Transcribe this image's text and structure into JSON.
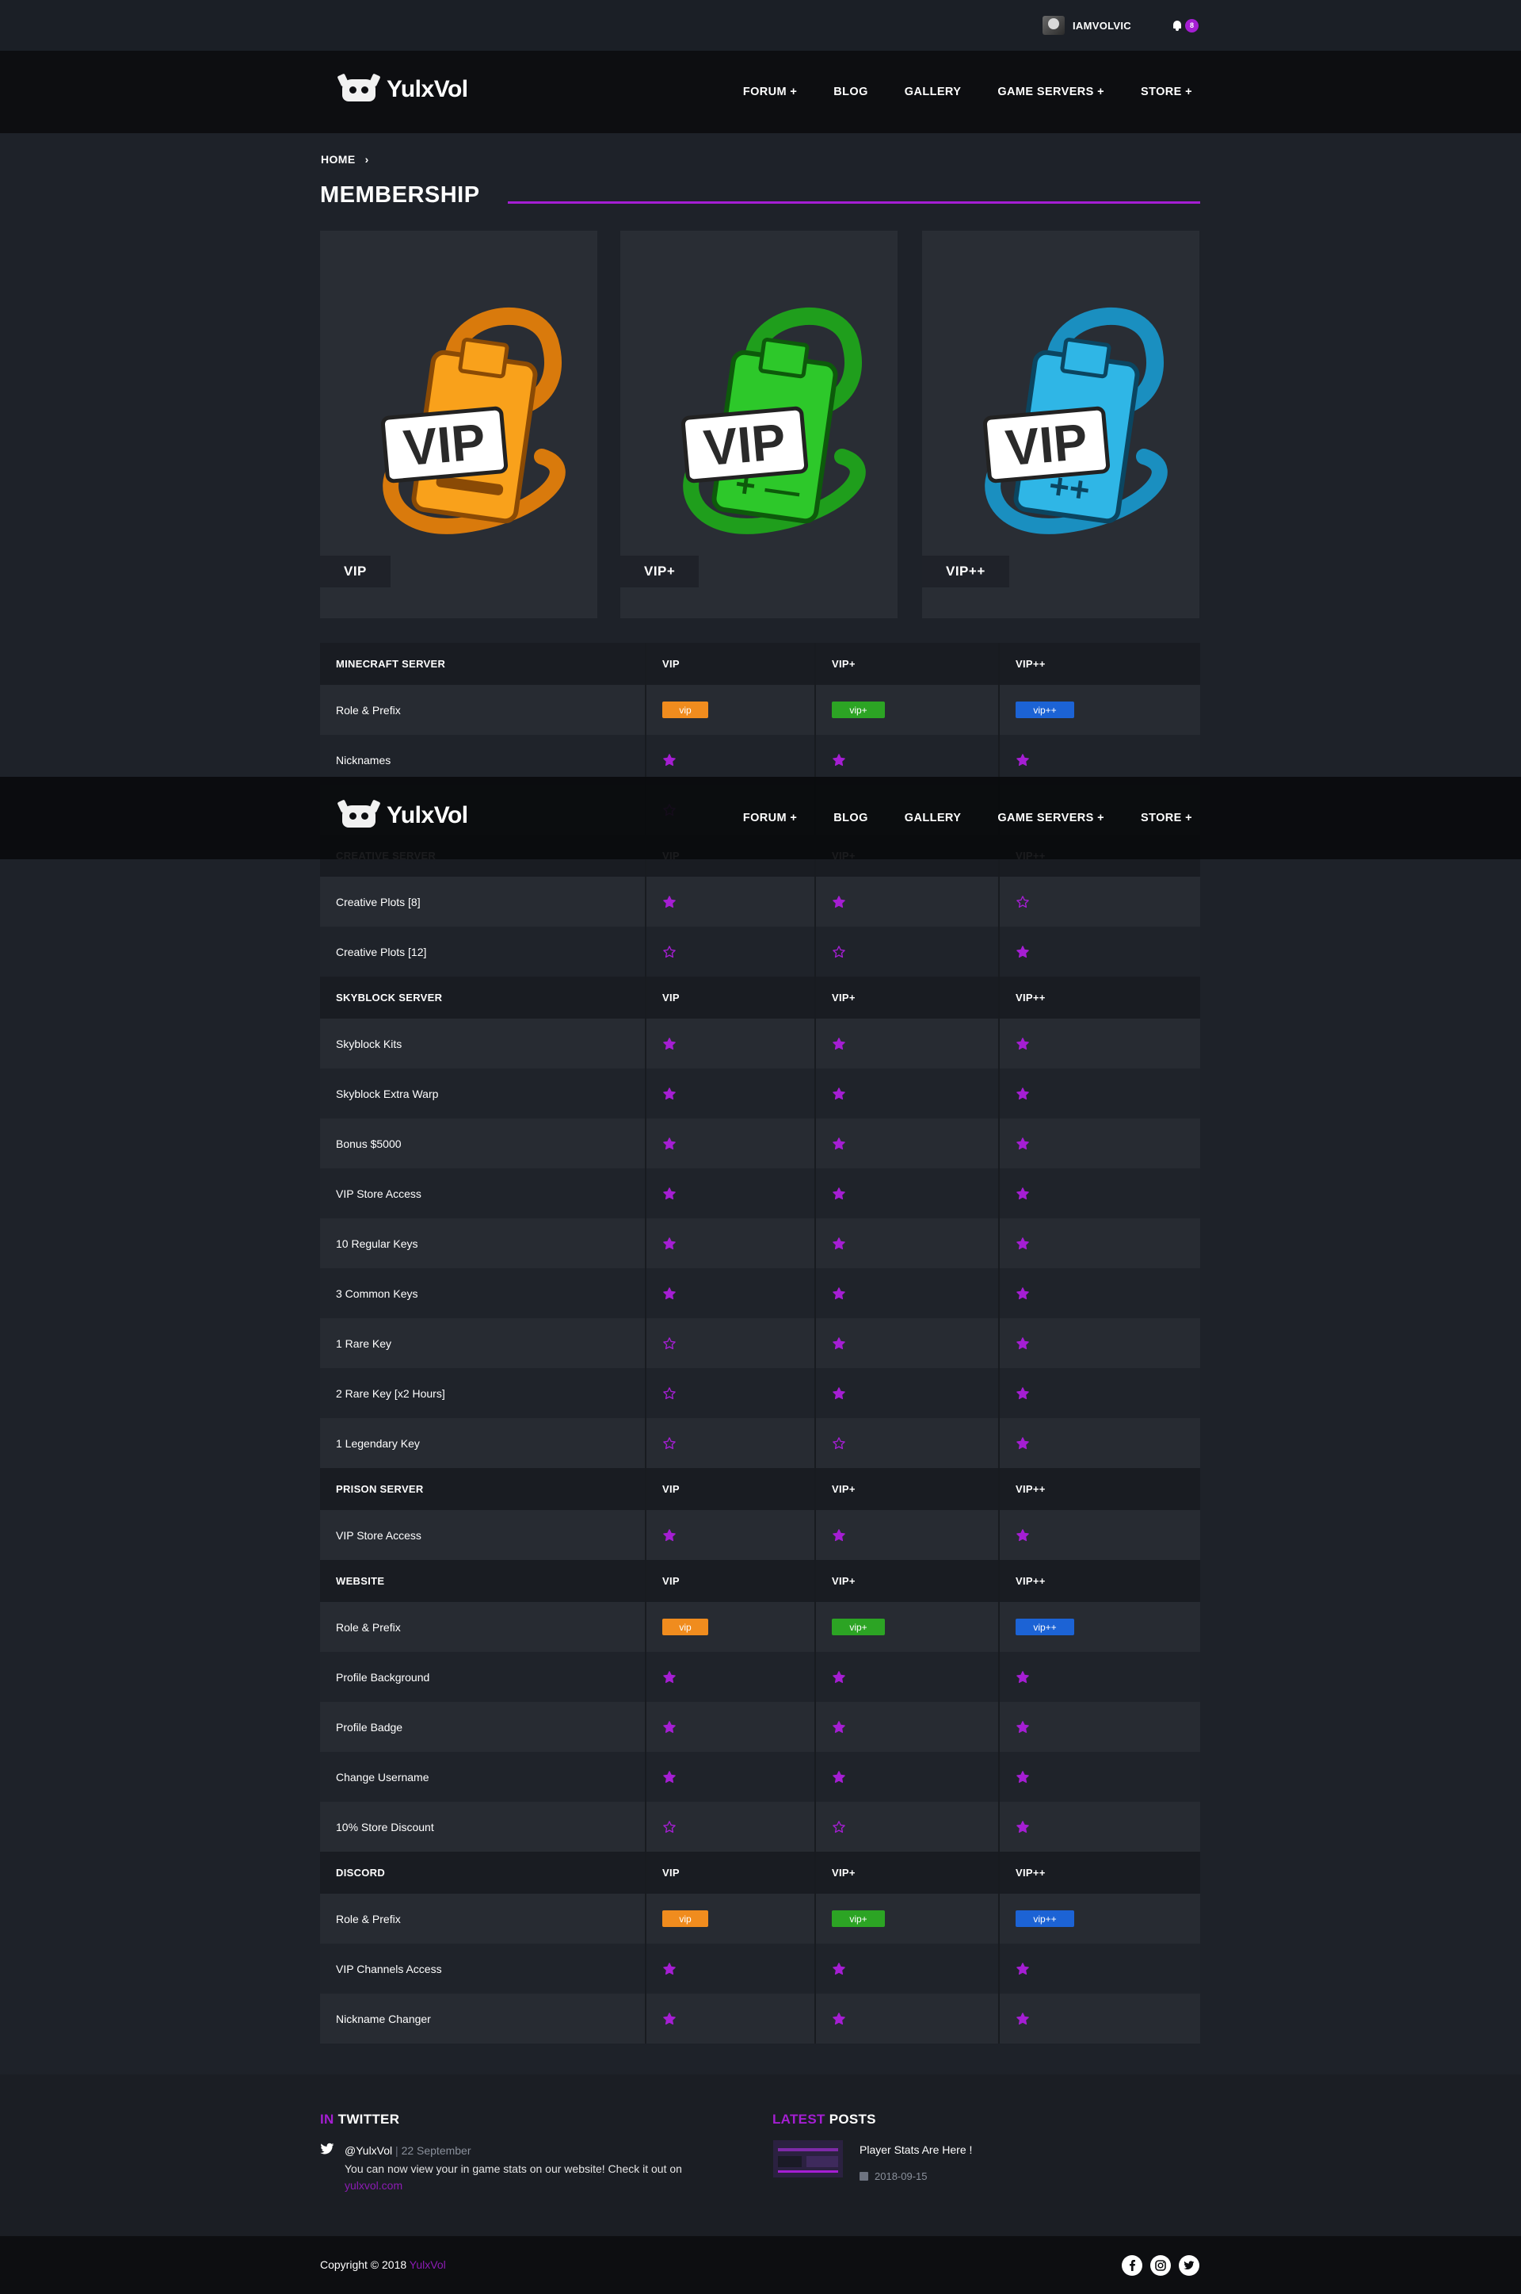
{
  "topbar": {
    "username": "IAMVOLVIC",
    "notification_count": "8"
  },
  "nav": {
    "brand": "YulxVol",
    "links": [
      "FORUM +",
      "BLOG",
      "GALLERY",
      "GAME SERVERS +",
      "STORE +"
    ]
  },
  "breadcrumb": {
    "home": "HOME"
  },
  "page_title": "MEMBERSHIP",
  "cards": [
    {
      "label": "VIP",
      "color": "#f9a11b",
      "marking": "none"
    },
    {
      "label": "VIP+",
      "color": "#2dc82a",
      "marking": "+"
    },
    {
      "label": "VIP++",
      "color": "#2fb6e6",
      "marking": "++"
    }
  ],
  "colors": {
    "accent": "#a51ed3",
    "tag_vip": "#f08c1e",
    "tag_vip_plus": "#2ca424",
    "tag_vip_plus_plus": "#1c63d5"
  },
  "table": {
    "sections": [
      {
        "title": "MINECRAFT SERVER",
        "cols": [
          "VIP",
          "VIP+",
          "VIP++"
        ],
        "rows": [
          {
            "label": "Role & Prefix",
            "type": "tag",
            "values": [
              "vip",
              "vip+",
              "vip++"
            ]
          },
          {
            "label": "Nicknames",
            "type": "star",
            "values": [
              true,
              true,
              true
            ]
          },
          {
            "label": "",
            "type": "star",
            "values": [
              false,
              null,
              null
            ]
          }
        ]
      },
      {
        "title": "CREATIVE SERVER",
        "cols": [
          "VIP",
          "VIP+",
          "VIP++"
        ],
        "rows": [
          {
            "label": "Creative Plots [8]",
            "type": "star",
            "values": [
              true,
              true,
              false
            ]
          },
          {
            "label": "Creative Plots [12]",
            "type": "star",
            "values": [
              false,
              false,
              true
            ]
          }
        ]
      },
      {
        "title": "SKYBLOCK SERVER",
        "cols": [
          "VIP",
          "VIP+",
          "VIP++"
        ],
        "rows": [
          {
            "label": "Skyblock Kits",
            "type": "star",
            "values": [
              true,
              true,
              true
            ]
          },
          {
            "label": "Skyblock Extra Warp",
            "type": "star",
            "values": [
              true,
              true,
              true
            ]
          },
          {
            "label": "Bonus $5000",
            "type": "star",
            "values": [
              true,
              true,
              true
            ]
          },
          {
            "label": "VIP Store Access",
            "type": "star",
            "values": [
              true,
              true,
              true
            ]
          },
          {
            "label": "10 Regular Keys",
            "type": "star",
            "values": [
              true,
              true,
              true
            ]
          },
          {
            "label": "3 Common Keys",
            "type": "star",
            "values": [
              true,
              true,
              true
            ]
          },
          {
            "label": "1 Rare Key",
            "type": "star",
            "values": [
              false,
              true,
              true
            ]
          },
          {
            "label": "2 Rare Key [x2 Hours]",
            "type": "star",
            "values": [
              false,
              true,
              true
            ]
          },
          {
            "label": "1 Legendary Key",
            "type": "star",
            "values": [
              false,
              false,
              true
            ]
          }
        ]
      },
      {
        "title": "PRISON SERVER",
        "cols": [
          "VIP",
          "VIP+",
          "VIP++"
        ],
        "rows": [
          {
            "label": "VIP Store Access",
            "type": "star",
            "values": [
              true,
              true,
              true
            ]
          }
        ]
      },
      {
        "title": "WEBSITE",
        "cols": [
          "VIP",
          "VIP+",
          "VIP++"
        ],
        "rows": [
          {
            "label": "Role & Prefix",
            "type": "tag",
            "values": [
              "vip",
              "vip+",
              "vip++"
            ]
          },
          {
            "label": "Profile Background",
            "type": "star",
            "values": [
              true,
              true,
              true
            ]
          },
          {
            "label": "Profile Badge",
            "type": "star",
            "values": [
              true,
              true,
              true
            ]
          },
          {
            "label": "Change Username",
            "type": "star",
            "values": [
              true,
              true,
              true
            ]
          },
          {
            "label": "10% Store Discount",
            "type": "star",
            "values": [
              false,
              false,
              true
            ]
          }
        ]
      },
      {
        "title": "DISCORD",
        "cols": [
          "VIP",
          "VIP+",
          "VIP++"
        ],
        "rows": [
          {
            "label": "Role & Prefix",
            "type": "tag",
            "values": [
              "vip",
              "vip+",
              "vip++"
            ]
          },
          {
            "label": "VIP Channels Access",
            "type": "star",
            "values": [
              true,
              true,
              true
            ]
          },
          {
            "label": "Nickname Changer",
            "type": "star",
            "values": [
              true,
              true,
              true
            ]
          }
        ]
      }
    ]
  },
  "footer": {
    "twitter": {
      "heading_accent": "IN",
      "heading_rest": "TWITTER",
      "handle": "@YulxVol",
      "separator": "|",
      "date": "22 September",
      "text": "You can now view your in game stats on our website! Check it out on",
      "link": "yulxvol.com"
    },
    "posts": {
      "heading_accent": "LATEST",
      "heading_rest": "POSTS",
      "title": "Player Stats Are Here !",
      "date": "2018-09-15"
    },
    "copyright_prefix": "Copyright © 2018",
    "copyright_brand": "YulxVol",
    "social": [
      "facebook-icon",
      "instagram-icon",
      "twitter-icon"
    ]
  }
}
